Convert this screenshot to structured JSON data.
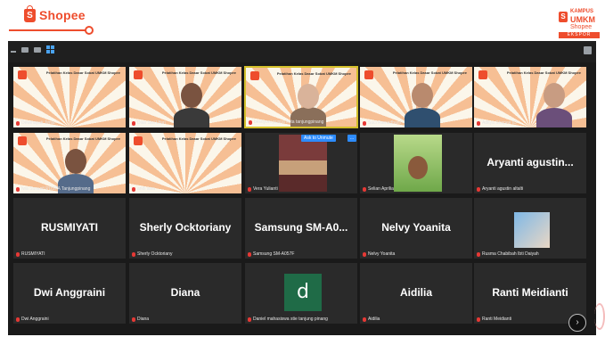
{
  "branding": {
    "shopee_bag_letter": "S",
    "shopee_text": "Shopee",
    "kampus_line1": "KAMPUS",
    "kampus_line2": "UMKM",
    "kampus_line3": "Shopee",
    "kampus_line4": "EKSPOR",
    "accent_color": "#ee4d2d"
  },
  "slide": {
    "title": "Pelatihan Kelas Dasar Sobat UMKM Shopee"
  },
  "participants": [
    {
      "name": "Dewinayati Jimia",
      "kind": "slide"
    },
    {
      "name": "Dian Sisi Utari",
      "kind": "slide-person"
    },
    {
      "name": "bestiyoni puspa kota tanjungpinang",
      "kind": "slide-person",
      "active": true
    },
    {
      "name": "Suci Ramadhani",
      "kind": "slide-person"
    },
    {
      "name": "Aditya Shopee ID",
      "kind": "slide-person"
    },
    {
      "name": "Iwa Susanti PUSPA Tanjungpinang",
      "kind": "slide-person"
    },
    {
      "name": "andi aisa",
      "kind": "slide"
    },
    {
      "name": "Vera Yulianti",
      "kind": "photo",
      "ask_to_unmute": "Ask to Unmute",
      "more": "…"
    },
    {
      "name": "Selian Aprilia",
      "kind": "photo"
    },
    {
      "name": "Aryanti agustin altalti",
      "kind": "text",
      "display": "Aryanti  agustin..."
    },
    {
      "name": "RUSMIYATI",
      "kind": "text",
      "display": "RUSMIYATI"
    },
    {
      "name": "Sherly Ocktoriany",
      "kind": "text",
      "display": "Sherly Ocktoriany"
    },
    {
      "name": "Samsung SM-A057F",
      "kind": "text",
      "display": "Samsung  SM-A0..."
    },
    {
      "name": "Nelvy Yoanita",
      "kind": "text",
      "display": "Nelvy Yoanita"
    },
    {
      "name": "Rusma Chabibah Ibti Daiyah",
      "kind": "photo"
    },
    {
      "name": "Dwi Anggraini",
      "kind": "text",
      "display": "Dwi Anggraini"
    },
    {
      "name": "Diana",
      "kind": "text",
      "display": "Diana"
    },
    {
      "name": "Daniel mahasiswa stie tanjung pinang",
      "kind": "avatar",
      "display": "d"
    },
    {
      "name": "Aidilia",
      "kind": "text",
      "display": "Aidilia"
    },
    {
      "name": "Ranti Meidianti",
      "kind": "text",
      "display": "Ranti Meidianti"
    }
  ],
  "controls": {
    "next_page": "›"
  }
}
